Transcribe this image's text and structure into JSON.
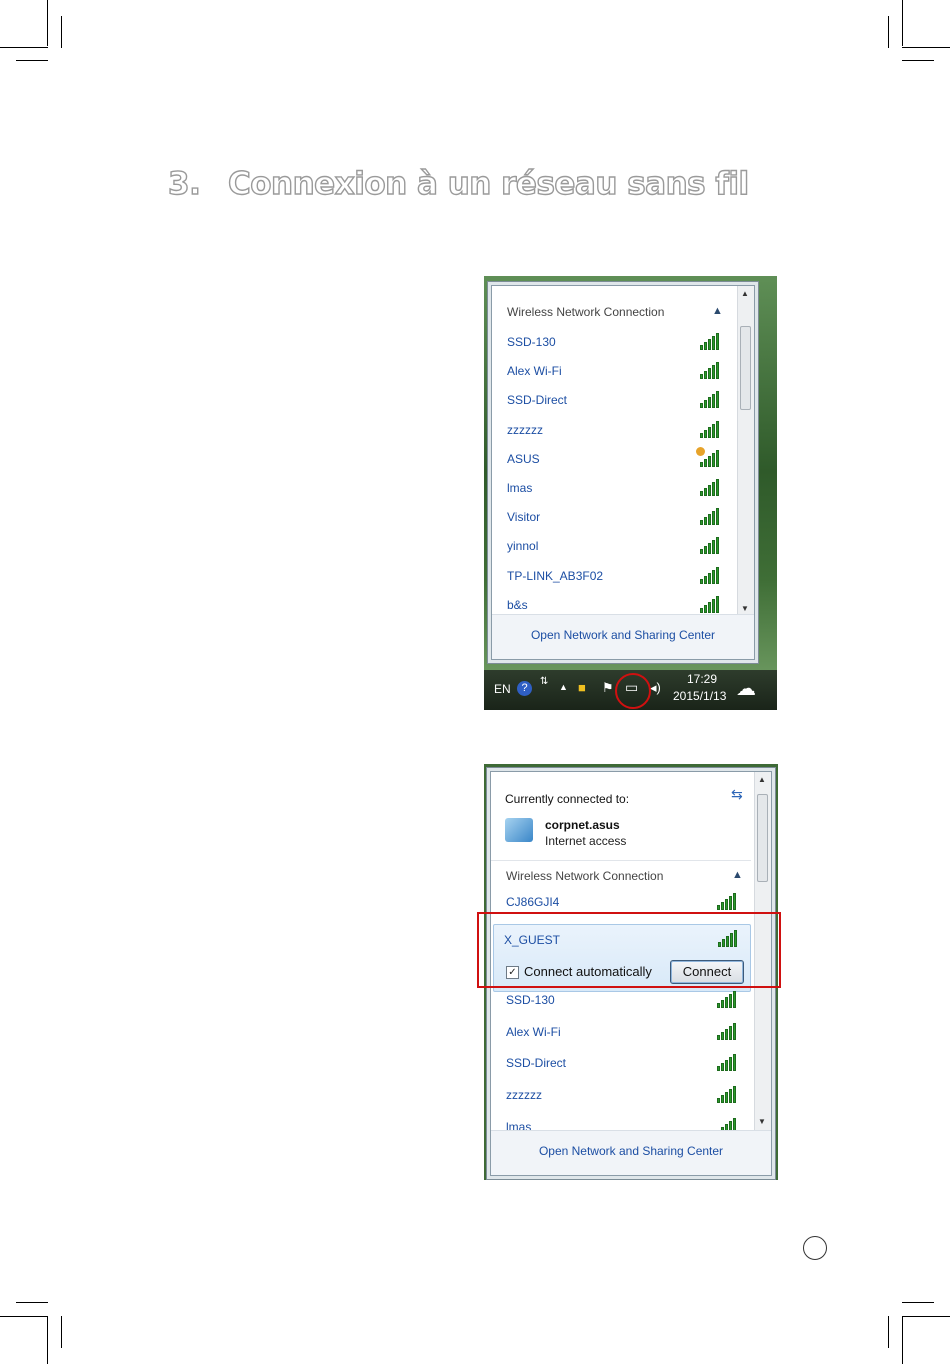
{
  "heading": {
    "number": "3.",
    "title": "Connexion à un réseau sans fil"
  },
  "screenshot1": {
    "section_title": "Wireless Network Connection",
    "networks": [
      {
        "name": "SSD-130"
      },
      {
        "name": "Alex Wi-Fi"
      },
      {
        "name": "SSD-Direct"
      },
      {
        "name": "zzzzzz"
      },
      {
        "name": "ASUS",
        "warning": true
      },
      {
        "name": "lmas"
      },
      {
        "name": "Visitor"
      },
      {
        "name": "yinnol"
      },
      {
        "name": "TP-LINK_AB3F02"
      },
      {
        "name": "b&s"
      }
    ],
    "footer_link": "Open Network and Sharing Center",
    "taskbar": {
      "language": "EN",
      "time": "17:29",
      "date": "2015/1/13"
    }
  },
  "screenshot2": {
    "connected_title": "Currently connected to:",
    "connected_network": "corpnet.asus",
    "connected_status": "Internet access",
    "section_title": "Wireless Network Connection",
    "networks_before": [
      {
        "name": "CJ86GJI4"
      }
    ],
    "selected_network": "X_GUEST",
    "connect_automatically_label": "Connect automatically",
    "connect_automatically_checked": true,
    "connect_button": "Connect",
    "networks_after": [
      {
        "name": "SSD-130"
      },
      {
        "name": "Alex Wi-Fi"
      },
      {
        "name": "SSD-Direct"
      },
      {
        "name": "zzzzzz"
      },
      {
        "name": "lmas"
      }
    ],
    "footer_link": "Open Network and Sharing Center"
  },
  "colors": {
    "link": "#1c4ea3",
    "highlight": "#d01010",
    "signal": "#2a9a2a"
  }
}
